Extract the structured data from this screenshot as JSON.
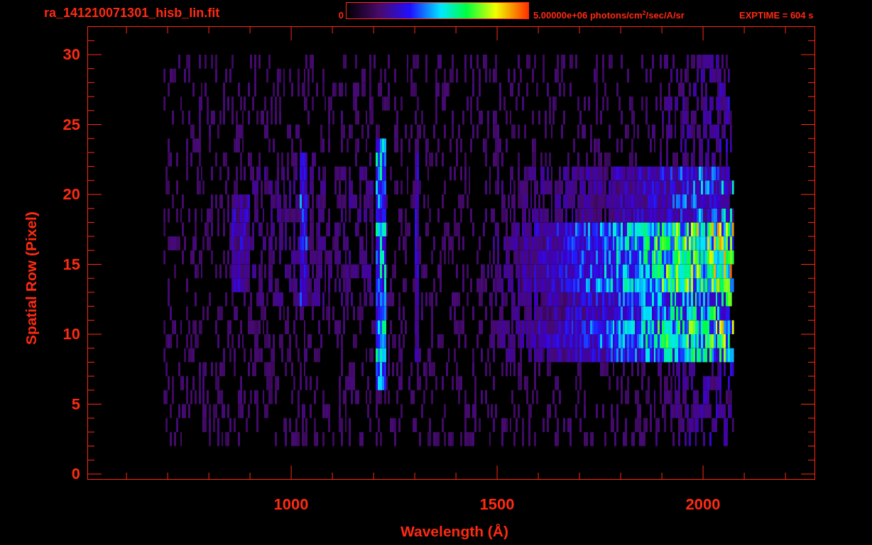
{
  "header": {
    "title": "ra_141210071301_hisb_lin.fit",
    "colorbar": {
      "min_label": "0",
      "max_label": "5.00000e+06 photons/cm$^{2}$/sec/A/sr"
    },
    "exposure": "EXPTIME = 604 s"
  },
  "plot": {
    "y_axis": {
      "label": "Spatial Row (Pixel)",
      "ticks": [
        "30",
        "25",
        "20",
        "15",
        "10",
        "5",
        "0"
      ]
    },
    "x_axis": {
      "label": "Wavelength (Å)",
      "ticks": [
        "1000",
        "1500",
        "2000"
      ]
    }
  }
}
